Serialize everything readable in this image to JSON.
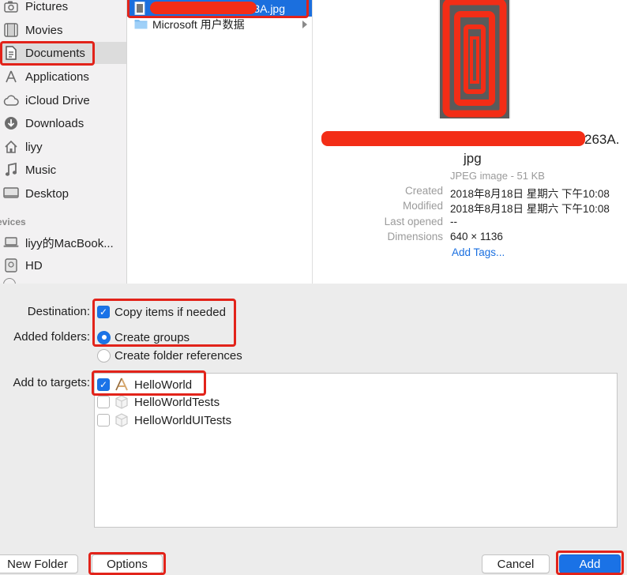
{
  "sidebar": {
    "items": [
      {
        "label": "Pictures",
        "icon": "camera-icon"
      },
      {
        "label": "Movies",
        "icon": "film-icon"
      },
      {
        "label": "Documents",
        "icon": "document-icon"
      },
      {
        "label": "Applications",
        "icon": "applications-icon"
      },
      {
        "label": "iCloud Drive",
        "icon": "cloud-icon"
      },
      {
        "label": "Downloads",
        "icon": "download-icon"
      },
      {
        "label": "liyy",
        "icon": "home-icon"
      },
      {
        "label": "Music",
        "icon": "music-icon"
      },
      {
        "label": "Desktop",
        "icon": "desktop-icon"
      }
    ],
    "devices_header": "evices",
    "devices": [
      {
        "label": "liyy的MacBook...",
        "icon": "laptop-icon"
      },
      {
        "label": "HD",
        "icon": "disk-icon"
      }
    ]
  },
  "column": {
    "files": [
      {
        "name": "63A.jpg",
        "type": "image"
      },
      {
        "name": "Microsoft 用户数据",
        "type": "folder"
      }
    ]
  },
  "preview": {
    "name_tail": "263A.",
    "name_ext": "jpg",
    "kind": "JPEG image - 51 KB",
    "meta": [
      {
        "key": "Created",
        "value": "2018年8月18日 星期六 下午10:08"
      },
      {
        "key": "Modified",
        "value": "2018年8月18日 星期六 下午10:08"
      },
      {
        "key": "Last opened",
        "value": "--"
      },
      {
        "key": "Dimensions",
        "value": "640 × 1136"
      }
    ],
    "add_tags": "Add Tags..."
  },
  "options": {
    "destination_label": "Destination:",
    "copy_items": {
      "label": "Copy items if needed",
      "checked": true
    },
    "added_folders_label": "Added folders:",
    "create_groups": {
      "label": "Create groups",
      "selected": true
    },
    "create_folder_refs": {
      "label": "Create folder references",
      "selected": false
    },
    "targets_label": "Add to targets:",
    "targets": [
      {
        "label": "HelloWorld",
        "checked": true,
        "icon": "app-target-icon"
      },
      {
        "label": "HelloWorldTests",
        "checked": false,
        "icon": "test-bundle-icon"
      },
      {
        "label": "HelloWorldUITests",
        "checked": false,
        "icon": "test-bundle-icon"
      }
    ]
  },
  "buttons": {
    "new_folder": "New Folder",
    "options": "Options",
    "cancel": "Cancel",
    "add": "Add"
  },
  "colors": {
    "accent": "#1a73e8",
    "annotation": "#e2231a",
    "redaction": "#f32d16"
  }
}
